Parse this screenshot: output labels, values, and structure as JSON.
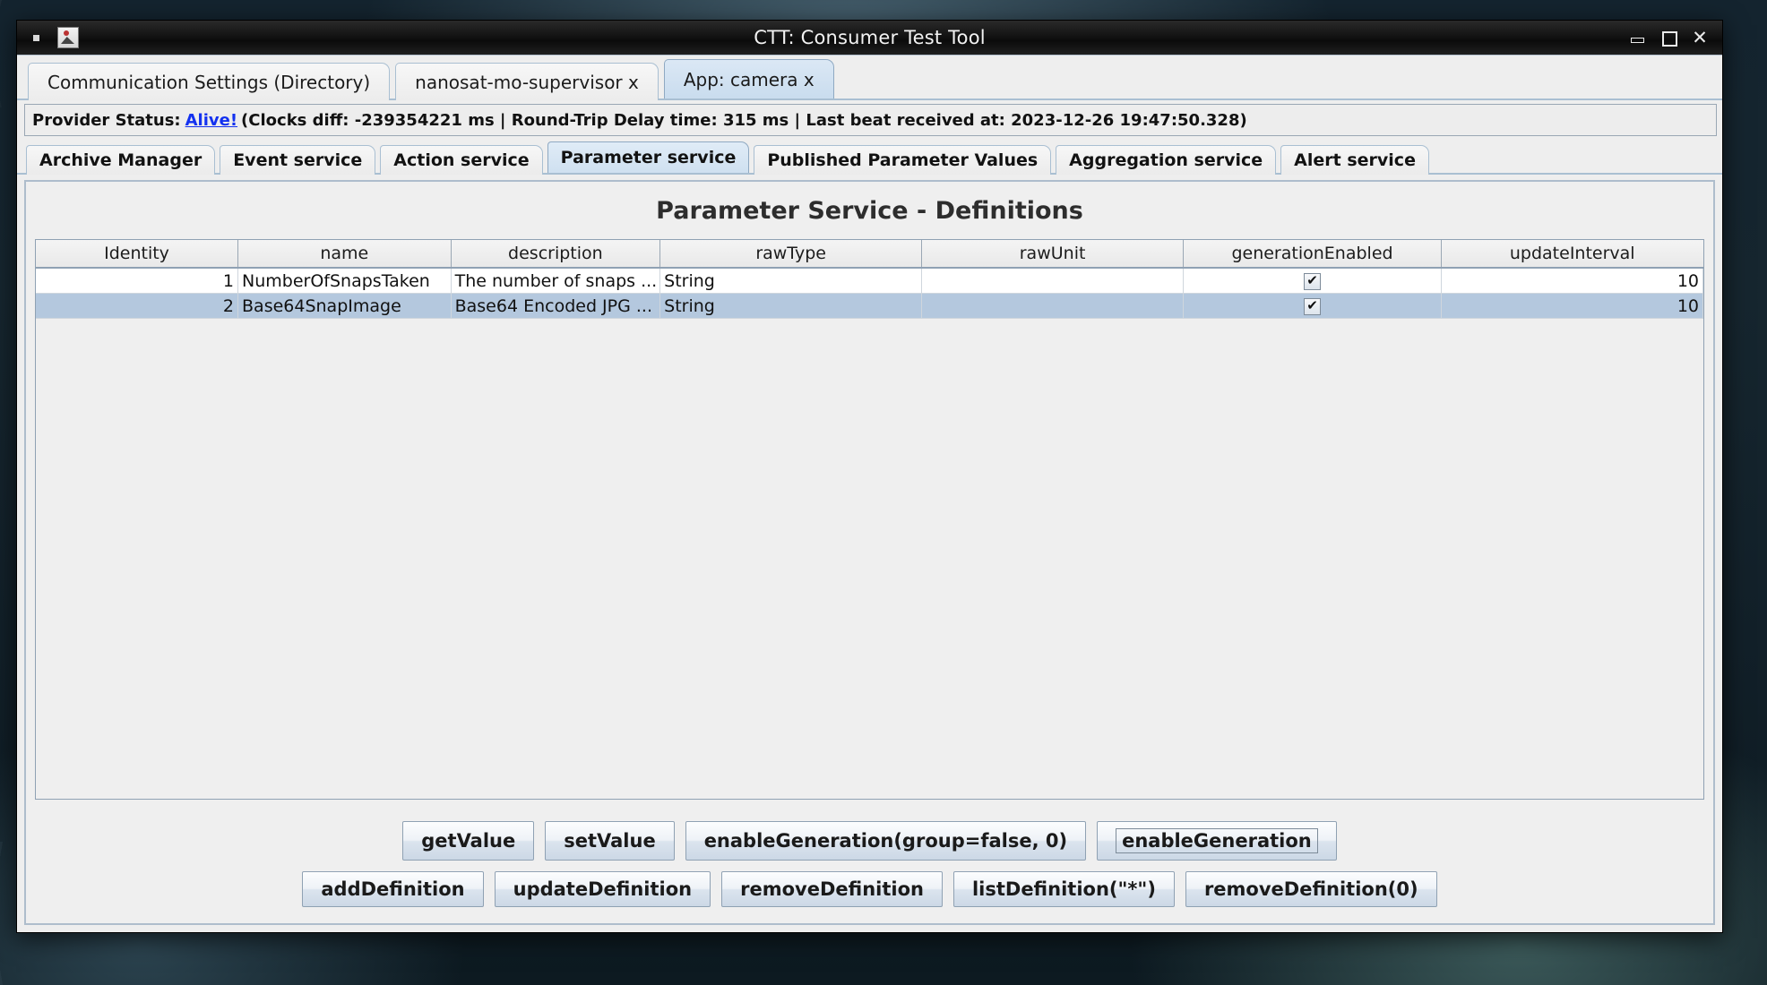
{
  "window": {
    "title": "CTT: Consumer Test Tool",
    "icon": "app-icon",
    "controls": {
      "minimize": "–",
      "maximize": "□",
      "close": "✕"
    }
  },
  "app_tabs": [
    {
      "label": "Communication Settings (Directory)",
      "active": false
    },
    {
      "label": "nanosat-mo-supervisor x",
      "active": false
    },
    {
      "label": "App: camera x",
      "active": true
    }
  ],
  "status": {
    "label": "Provider Status:",
    "value": "Alive!",
    "value_color": "#1331f0",
    "details": "(Clocks diff: -239354221 ms | Round-Trip Delay time: 315 ms | Last beat received at: 2023-12-26 19:47:50.328)",
    "clocks_diff_ms": "-239354221",
    "round_trip_delay_ms": "315",
    "last_beat_received_at": "2023-12-26 19:47:50.328"
  },
  "service_tabs": [
    {
      "label": "Archive Manager",
      "active": false
    },
    {
      "label": "Event service",
      "active": false
    },
    {
      "label": "Action service",
      "active": false
    },
    {
      "label": "Parameter service",
      "active": true
    },
    {
      "label": "Published Parameter Values",
      "active": false
    },
    {
      "label": "Aggregation service",
      "active": false
    },
    {
      "label": "Alert service",
      "active": false
    }
  ],
  "panel": {
    "title": "Parameter Service - Definitions",
    "table": {
      "columns": [
        "Identity",
        "name",
        "description",
        "rawType",
        "rawUnit",
        "generationEnabled",
        "updateInterval"
      ],
      "rows": [
        {
          "selected": false,
          "identity": "1",
          "name": "NumberOfSnapsTaken",
          "description": "The number of snaps ...",
          "rawType": "String",
          "rawUnit": "",
          "generationEnabled": "✔",
          "updateInterval": "10"
        },
        {
          "selected": true,
          "identity": "2",
          "name": "Base64SnapImage",
          "description": "Base64 Encoded JPG ...",
          "rawType": "String",
          "rawUnit": "",
          "generationEnabled": "✔",
          "updateInterval": "10"
        }
      ]
    }
  },
  "buttons": {
    "row1": [
      {
        "label": "getValue",
        "focused": false
      },
      {
        "label": "setValue",
        "focused": false
      },
      {
        "label": "enableGeneration(group=false, 0)",
        "focused": false
      },
      {
        "label": "enableGeneration",
        "focused": true
      }
    ],
    "row2": [
      {
        "label": "addDefinition",
        "focused": false
      },
      {
        "label": "updateDefinition",
        "focused": false
      },
      {
        "label": "removeDefinition",
        "focused": false
      },
      {
        "label": "listDefinition(\"*\")",
        "focused": false
      },
      {
        "label": "removeDefinition(0)",
        "focused": false
      }
    ]
  },
  "colors": {
    "tab_active": "#cfe0f0",
    "row_selected": "#b4c8de",
    "link": "#1331f0",
    "panel_bg": "#efefef"
  }
}
